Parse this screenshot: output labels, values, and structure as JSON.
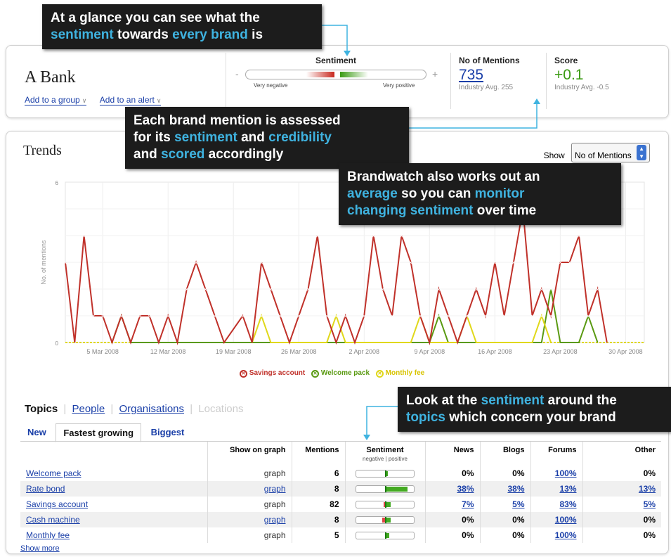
{
  "callouts": {
    "c1": {
      "l1_a": "At a glance you can see what the",
      "l2_hl1": "sentiment",
      "l2_mid": " towards ",
      "l2_hl2": "every brand",
      "l2_end": " is"
    },
    "c2": {
      "l1": "Each brand mention is assessed",
      "l2_a": "for its ",
      "l2_hl1": "sentiment",
      "l2_mid": " and ",
      "l2_hl2": "credibility",
      "l3_a": "and ",
      "l3_hl": "scored",
      "l3_end": " accordingly"
    },
    "c3": {
      "l1": "Brandwatch also works out an",
      "l2_hl1": "average",
      "l2_mid": " so you can ",
      "l2_hl2": "monitor",
      "l3_hl": "changing sentiment",
      "l3_end": " over time"
    },
    "c4": {
      "l1_a": "Look at the ",
      "l1_hl": "sentiment",
      "l1_end": " around the",
      "l2_hl": "topics",
      "l2_end": " which concern your brand"
    }
  },
  "brand": {
    "name": "A Bank",
    "add_group": "Add to a group",
    "add_alert": "Add to an alert"
  },
  "sentiment": {
    "title": "Sentiment",
    "minus": "-",
    "plus": "+",
    "very_negative": "Very negative",
    "very_positive": "Very positive"
  },
  "mentions": {
    "title": "No of Mentions",
    "value": "735",
    "avg": "Industry Avg. 255"
  },
  "score": {
    "title": "Score",
    "value": "+0.1",
    "avg": "Industry Avg. -0.5"
  },
  "trends": {
    "title": "Trends",
    "show_label": "Show",
    "show_value": "No of Mentions"
  },
  "colors": {
    "savings": "#c0312a",
    "welcome": "#5a9a12",
    "monthly": "#e0d81a",
    "accent": "#3fb3e0"
  },
  "chart_data": {
    "type": "line",
    "title": "",
    "ylabel": "No. of mentions",
    "ylim": [
      0,
      6
    ],
    "yticks": [
      "0",
      "6"
    ],
    "x_tick_labels": [
      "5 Mar 2008",
      "12 Mar 2008",
      "19 Mar 2008",
      "26 Mar 2008",
      "2 Apr 2008",
      "9 Apr 2008",
      "16 Apr 2008",
      "23 Apr 2008",
      "30 Apr 2008"
    ],
    "x_tick_days": [
      5,
      12,
      19,
      26,
      33,
      40,
      47,
      54,
      61
    ],
    "x_start_day": 1,
    "x_end_day": 63,
    "series": [
      {
        "name": "Savings account",
        "color": "#c0312a",
        "points": [
          [
            1,
            3
          ],
          [
            2,
            0
          ],
          [
            3,
            4
          ],
          [
            4,
            1
          ],
          [
            5,
            1
          ],
          [
            6,
            0
          ],
          [
            7,
            1
          ],
          [
            8,
            0
          ],
          [
            9,
            1
          ],
          [
            10,
            1
          ],
          [
            11,
            0
          ],
          [
            12,
            1
          ],
          [
            13,
            0
          ],
          [
            14,
            2
          ],
          [
            15,
            3
          ],
          [
            16,
            2
          ],
          [
            17,
            1
          ],
          [
            18,
            0
          ],
          [
            20,
            1
          ],
          [
            21,
            0
          ],
          [
            22,
            3
          ],
          [
            23,
            2
          ],
          [
            24,
            1
          ],
          [
            25,
            0
          ],
          [
            26,
            1
          ],
          [
            27,
            2
          ],
          [
            28,
            4
          ],
          [
            29,
            1
          ],
          [
            30,
            0
          ],
          [
            31,
            1
          ],
          [
            32,
            0
          ],
          [
            33,
            1
          ],
          [
            34,
            4
          ],
          [
            35,
            2
          ],
          [
            36,
            1
          ],
          [
            37,
            4
          ],
          [
            38,
            3
          ],
          [
            39,
            1
          ],
          [
            40,
            0
          ],
          [
            41,
            2
          ],
          [
            42,
            1
          ],
          [
            43,
            0
          ],
          [
            44,
            1
          ],
          [
            45,
            2
          ],
          [
            46,
            1
          ],
          [
            47,
            3
          ],
          [
            48,
            1
          ],
          [
            49,
            3
          ],
          [
            50,
            5
          ],
          [
            51,
            1
          ],
          [
            52,
            2
          ],
          [
            53,
            1
          ],
          [
            54,
            3
          ],
          [
            55,
            3
          ],
          [
            56,
            4
          ],
          [
            57,
            1
          ],
          [
            58,
            2
          ],
          [
            59,
            0
          ]
        ]
      },
      {
        "name": "Welcome pack",
        "color": "#5a9a12",
        "points": [
          [
            6,
            0
          ],
          [
            7,
            1
          ],
          [
            8,
            0
          ],
          [
            40,
            0
          ],
          [
            41,
            1
          ],
          [
            42,
            0
          ],
          [
            52,
            0
          ],
          [
            53,
            2
          ],
          [
            54,
            0
          ],
          [
            56,
            0
          ],
          [
            57,
            1
          ],
          [
            58,
            0
          ]
        ]
      },
      {
        "name": "Monthly fee",
        "color": "#e0d81a",
        "points": [
          [
            21,
            0
          ],
          [
            22,
            1
          ],
          [
            23,
            0
          ],
          [
            29,
            0
          ],
          [
            30,
            1
          ],
          [
            31,
            0
          ],
          [
            38,
            0
          ],
          [
            39,
            1
          ],
          [
            40,
            0
          ],
          [
            43,
            0
          ],
          [
            44,
            1
          ],
          [
            45,
            0
          ],
          [
            51,
            0
          ],
          [
            52,
            1
          ],
          [
            53,
            0
          ]
        ]
      }
    ],
    "legend": [
      "Savings account",
      "Welcome pack",
      "Monthly fee"
    ],
    "legend_position": "bottom"
  },
  "topics": {
    "tabs": [
      "Topics",
      "People",
      "Organisations",
      "Locations"
    ],
    "subtabs": [
      "New",
      "Fastest growing",
      "Biggest"
    ],
    "columns": {
      "show": "Show on graph",
      "mentions": "Mentions",
      "sentiment": "Sentiment",
      "sentiment_sub": "negative | positive",
      "news": "News",
      "blogs": "Blogs",
      "forums": "Forums",
      "other": "Other"
    },
    "rows": [
      {
        "name": "Welcome pack",
        "graph": "graph",
        "mentions": "6",
        "neg": 0,
        "pos": 0.05,
        "news": "0%",
        "blogs": "0%",
        "forums": "100%",
        "other": "0%"
      },
      {
        "name": "Rate bond",
        "graph": "graph",
        "mentions": "8",
        "neg": 0,
        "pos": 0.75,
        "news": "38%",
        "blogs": "38%",
        "forums": "13%",
        "other": "13%"
      },
      {
        "name": "Savings account",
        "graph": "graph",
        "mentions": "82",
        "neg": 0.05,
        "pos": 0.15,
        "news": "7%",
        "blogs": "5%",
        "forums": "83%",
        "other": "5%"
      },
      {
        "name": "Cash machine",
        "graph": "graph",
        "mentions": "8",
        "neg": 0.1,
        "pos": 0.15,
        "news": "0%",
        "blogs": "0%",
        "forums": "100%",
        "other": "0%"
      },
      {
        "name": "Monthly fee",
        "graph": "graph",
        "mentions": "5",
        "neg": 0,
        "pos": 0.1,
        "news": "0%",
        "blogs": "0%",
        "forums": "100%",
        "other": "0%"
      }
    ],
    "show_more": "Show more"
  }
}
